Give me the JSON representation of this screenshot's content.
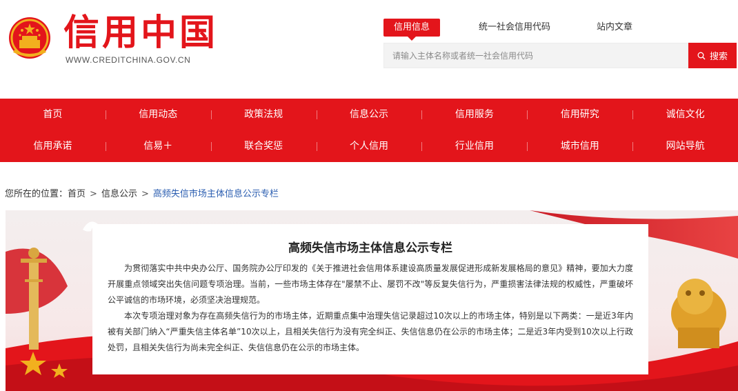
{
  "header": {
    "logo_title": "信用中国",
    "logo_url": "WWW.CREDITCHINA.GOV.CN",
    "search_tabs": [
      "信用信息",
      "统一社会信用代码",
      "站内文章"
    ],
    "search_placeholder": "请输入主体名称或者统一社会信用代码",
    "search_button": "搜索"
  },
  "nav": {
    "row1": [
      "首页",
      "信用动态",
      "政策法规",
      "信息公示",
      "信用服务",
      "信用研究",
      "诚信文化"
    ],
    "row2": [
      "信用承诺",
      "信易＋",
      "联合奖惩",
      "个人信用",
      "行业信用",
      "城市信用",
      "网站导航"
    ]
  },
  "breadcrumb": {
    "prefix": "您所在的位置：",
    "home": "首页",
    "sep": ">",
    "level1": "信息公示",
    "current": "高频失信市场主体信息公示专栏"
  },
  "notice": {
    "title": "高频失信市场主体信息公示专栏",
    "para1": "为贯彻落实中共中央办公厅、国务院办公厅印发的《关于推进社会信用体系建设高质量发展促进形成新发展格局的意见》精神，要加大力度开展重点领域突出失信问题专项治理。当前，一些市场主体存在\"屡禁不止、屡罚不改\"等反复失信行为，严重损害法律法规的权威性，严重破坏公平诚信的市场环境，必须坚决治理规范。",
    "para2": "本次专项治理对象为存在高频失信行为的市场主体，近期重点集中治理失信记录超过10次以上的市场主体，特别是以下两类：一是近3年内被有关部门纳入“严重失信主体名单”10次以上，且相关失信行为没有完全纠正、失信信息仍在公示的市场主体；二是近3年内受到10次以上行政处罚，且相关失信行为尚未完全纠正、失信信息仍在公示的市场主体。"
  },
  "colors": {
    "brand_red": "#e3151b",
    "gold": "#f2b01e",
    "link_blue": "#2a5db0"
  }
}
